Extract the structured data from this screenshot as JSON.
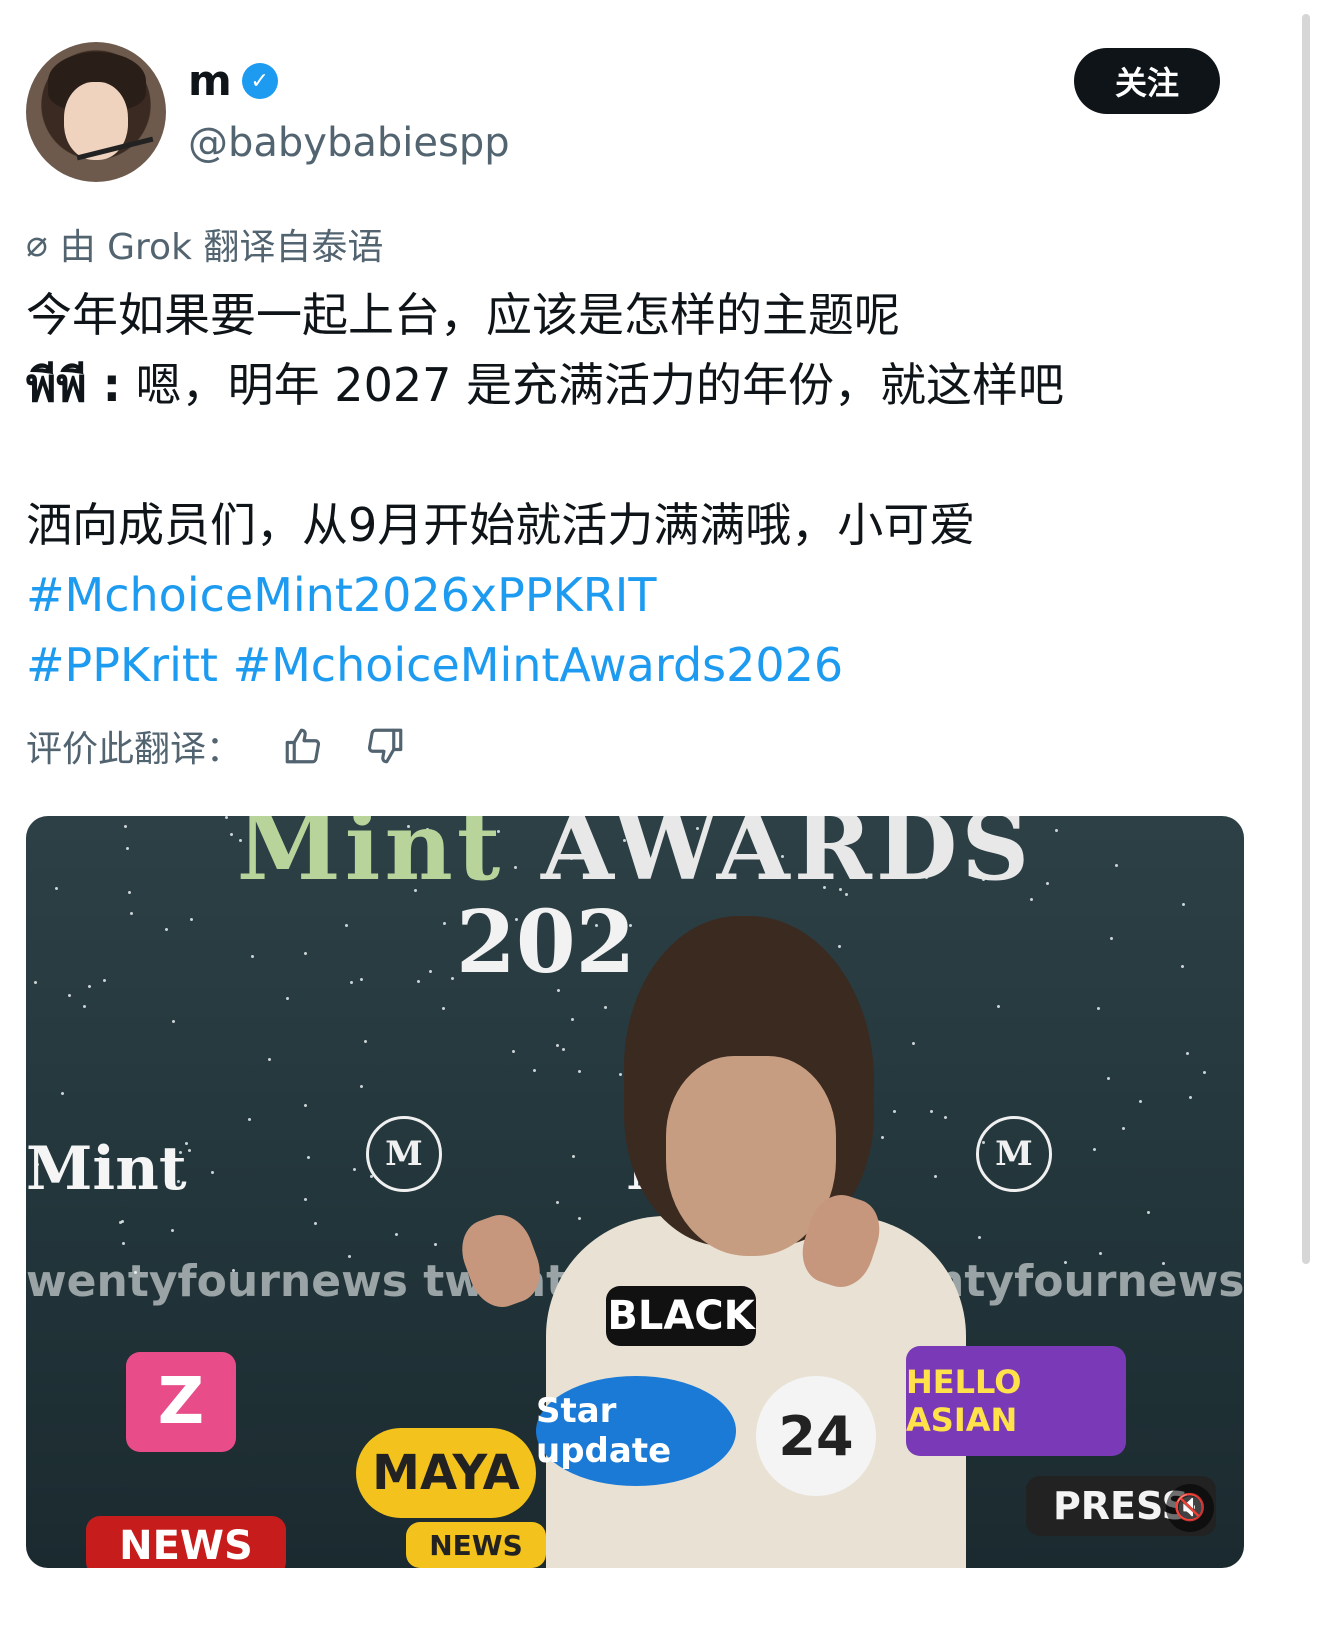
{
  "user": {
    "name": "m",
    "handle": "@babybabiespp",
    "follow_label": "关注"
  },
  "translation_note": {
    "icon": "grok-slash-icon",
    "text": "由 Grok 翻译自泰语"
  },
  "post": {
    "line1": "今年如果要一起上台，应该是怎样的主题呢",
    "line2_prefix": "พีพี :",
    "line2_rest": " 嗯，明年 2027 是充满活力的年份，就这样吧",
    "line3": "洒向成员们，从9月开始就活力满满哦，小可爱",
    "hashtag1": "#MchoiceMint2026xPPKRIT",
    "hashtag2": "#PPKritt",
    "hashtag3": "#MchoiceMintAwards2026"
  },
  "rate": {
    "label": "评价此翻译："
  },
  "media": {
    "title_green": "Mint",
    "title_white": " AWARDS",
    "year": "202",
    "brand_left": "Mint",
    "brand_mid": "M",
    "logo_text": "M",
    "watermark": "wentyfournews twentyfournews twentyfournews twentyfournews",
    "mic_labels": [
      "Z",
      "MAYA",
      "NEWS",
      "Star update",
      "HELLO ASIAN",
      "24",
      "PRESS",
      "BLACK",
      "NEWS"
    ]
  },
  "colors": {
    "link": "#1d9bf0",
    "muted": "#536471",
    "text": "#0f1419"
  }
}
